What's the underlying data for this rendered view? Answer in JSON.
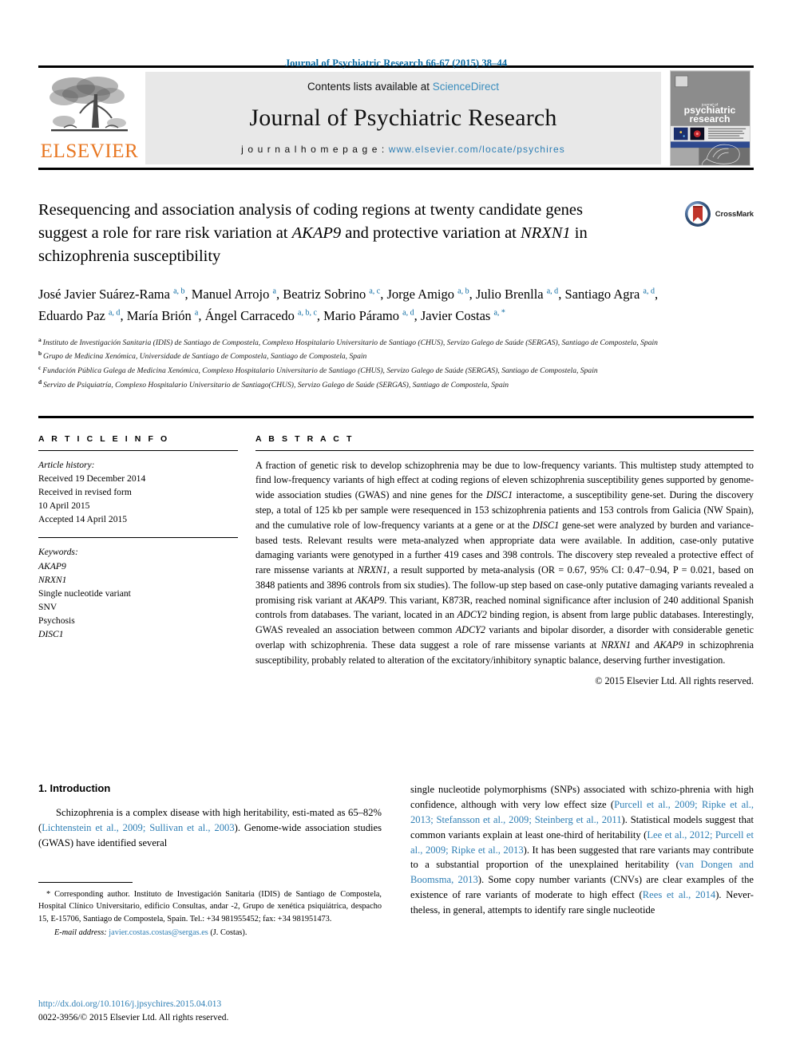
{
  "running_head": "Journal of Psychiatric Research 66-67 (2015) 38–44",
  "masthead": {
    "contents_prefix": "Contents lists available at ",
    "sciencedirect": "ScienceDirect",
    "journal_title": "Journal of Psychiatric Research",
    "homepage_prefix": "j o u r n a l   h o m e p a g e :  ",
    "homepage_url": "www.elsevier.com/locate/psychires",
    "publisher": "ELSEVIER",
    "cover_title_line1": "psychiatric",
    "cover_title_line2": "research"
  },
  "crossmark": {
    "label": "CrossMark"
  },
  "title": {
    "line1": "Resequencing and association analysis of coding regions at twenty",
    "line2_a": "candidate genes suggest a role for rare risk variation at ",
    "line2_gene": "AKAP9",
    "line2_b": " and",
    "line3_a": "protective variation at ",
    "line3_gene": "NRXN1",
    "line3_b": " in schizophrenia susceptibility"
  },
  "authors": [
    {
      "name": "José Javier Suárez-Rama",
      "sup": "a, b",
      "sep": ", "
    },
    {
      "name": "Manuel Arrojo",
      "sup": "a",
      "sep": ", "
    },
    {
      "name": "Beatriz Sobrino",
      "sup": "a, c",
      "sep": ", "
    },
    {
      "name": "Jorge Amigo",
      "sup": "a, b",
      "sep": ", "
    },
    {
      "name": "Julio Brenlla",
      "sup": "a, d",
      "sep": ", "
    },
    {
      "name": "Santiago Agra",
      "sup": "a, d",
      "sep": ", "
    },
    {
      "name": "Eduardo Paz",
      "sup": "a, d",
      "sep": ", "
    },
    {
      "name": "María Brión",
      "sup": "a",
      "sep": ", "
    },
    {
      "name": "Ángel Carracedo",
      "sup": "a, b, c",
      "sep": ", "
    },
    {
      "name": "Mario Páramo",
      "sup": "a, d",
      "sep": ", "
    },
    {
      "name": "Javier Costas",
      "sup": "a, *",
      "sep": ""
    }
  ],
  "affiliations": [
    {
      "mark": "a",
      "text": "Instituto de Investigación Sanitaria (IDIS) de Santiago de Compostela, Complexo Hospitalario Universitario de Santiago (CHUS), Servizo Galego de Saúde (SERGAS), Santiago de Compostela, Spain"
    },
    {
      "mark": "b",
      "text": "Grupo de Medicina Xenómica, Universidade de Santiago de Compostela, Santiago de Compostela, Spain"
    },
    {
      "mark": "c",
      "text": "Fundación Pública Galega de Medicina Xenómica, Complexo Hospitalario Universitario de Santiago (CHUS), Servizo Galego de Saúde (SERGAS), Santiago de Compostela, Spain"
    },
    {
      "mark": "d",
      "text": "Servizo de Psiquiatría, Complexo Hospitalario Universitario de Santiago(CHUS), Servizo Galego de Saúde (SERGAS), Santiago de Compostela, Spain"
    }
  ],
  "article_info": {
    "heading": "A R T I C L E   I N F O",
    "history_label": "Article history:",
    "history_lines": [
      "Received 19 December 2014",
      "Received in revised form",
      "10 April 2015",
      "Accepted 14 April 2015"
    ],
    "keywords_label": "Keywords:",
    "keywords": [
      "AKAP9",
      "NRXN1",
      "Single nucleotide variant",
      "SNV",
      "Psychosis",
      "DISC1"
    ]
  },
  "abstract": {
    "heading": "A B S T R A C T",
    "text": "A fraction of genetic risk to develop schizophrenia may be due to low-frequency variants. This multistep study attempted to find low-frequency variants of high effect at coding regions of eleven schizophrenia susceptibility genes supported by genome-wide association studies (GWAS) and nine genes for the DISC1 interactome, a susceptibility gene-set. During the discovery step, a total of 125 kb per sample were resequenced in 153 schizophrenia patients and 153 controls from Galicia (NW Spain), and the cumulative role of low-frequency variants at a gene or at the DISC1 gene-set were analyzed by burden and variance-based tests. Relevant results were meta-analyzed when appropriate data were available. In addition, case-only putative damaging variants were genotyped in a further 419 cases and 398 controls. The discovery step revealed a protective effect of rare missense variants at NRXN1, a result supported by meta-analysis (OR = 0.67, 95% CI: 0.47−0.94, P = 0.021, based on 3848 patients and 3896 controls from six studies). The follow-up step based on case-only putative damaging variants revealed a promising risk variant at AKAP9. This variant, K873R, reached nominal significance after inclusion of 240 additional Spanish controls from databases. The variant, located in an ADCY2 binding region, is absent from large public databases. Interestingly, GWAS revealed an association between common ADCY2 variants and bipolar disorder, a disorder with considerable genetic overlap with schizophrenia. These data suggest a role of rare missense variants at NRXN1 and AKAP9 in schizophrenia susceptibility, probably related to alteration of the excitatory/inhibitory synaptic balance, deserving further investigation.",
    "copyright": "© 2015 Elsevier Ltd. All rights reserved."
  },
  "introduction": {
    "heading": "1.  Introduction",
    "left_paragraph_parts": [
      {
        "t": "Schizophrenia is a complex disease with high heritability, esti-mated as 65–82% (",
        "link": false
      },
      {
        "t": "Lichtenstein et al., 2009; Sullivan et al., 2003",
        "link": true
      },
      {
        "t": "). Genome-wide association studies (GWAS) have identified several",
        "link": false
      }
    ],
    "right_paragraph_parts": [
      {
        "t": "single nucleotide polymorphisms (SNPs) associated with schizo-phrenia with high confidence, although with very low effect size (",
        "link": false
      },
      {
        "t": "Purcell et al., 2009; Ripke et al., 2013; Stefansson et al., 2009; Steinberg et al., 2011",
        "link": true
      },
      {
        "t": "). Statistical models suggest that common variants explain at least one-third of heritability (",
        "link": false
      },
      {
        "t": "Lee et al., 2012; Purcell et al., 2009; Ripke et al., 2013",
        "link": true
      },
      {
        "t": "). It has been suggested that rare variants may contribute to a substantial proportion of the unexplained heritability (",
        "link": false
      },
      {
        "t": "van Dongen and Boomsma, 2013",
        "link": true
      },
      {
        "t": "). Some copy number variants (CNVs) are clear examples of the existence of rare variants of moderate to high effect (",
        "link": false
      },
      {
        "t": "Rees et al., 2014",
        "link": true
      },
      {
        "t": "). Never-theless, in general, attempts to identify rare single nucleotide",
        "link": false
      }
    ]
  },
  "footnotes": {
    "corresponding": "* Corresponding author. Instituto de Investigación Sanitaria (IDIS) de Santiago de Compostela, Hospital Clínico Universitario, edificio Consultas, andar -2, Grupo de xenética psiquiátrica, despacho 15, E-15706, Santiago de Compostela, Spain. Tel.: +34 981955452; fax: +34 981951473.",
    "email_label": "E-mail address:",
    "email": "javier.costas.costas@sergas.es",
    "email_suffix": "(J. Costas)."
  },
  "doi": {
    "url": "http://dx.doi.org/10.1016/j.jpsychires.2015.04.013",
    "issn_line": "0022-3956/© 2015 Elsevier Ltd. All rights reserved."
  },
  "colors": {
    "link": "#2f7fb5",
    "running_head": "#0b6aa2",
    "elsevier_orange": "#E87722"
  }
}
